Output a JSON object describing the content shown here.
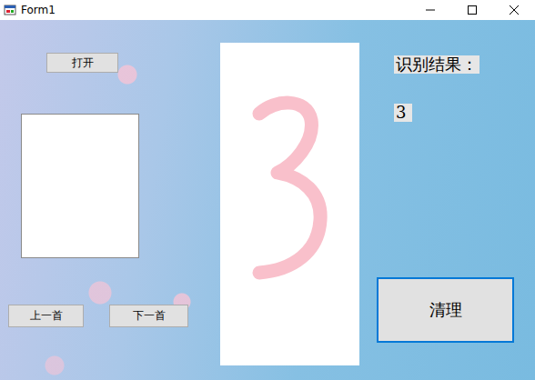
{
  "window": {
    "title": "Form1"
  },
  "buttons": {
    "open": "打开",
    "prev": "上一首",
    "next": "下一首",
    "clear": {
      "label": "清理",
      "focused": true
    }
  },
  "result": {
    "caption": "识别结果：",
    "value": "3"
  }
}
